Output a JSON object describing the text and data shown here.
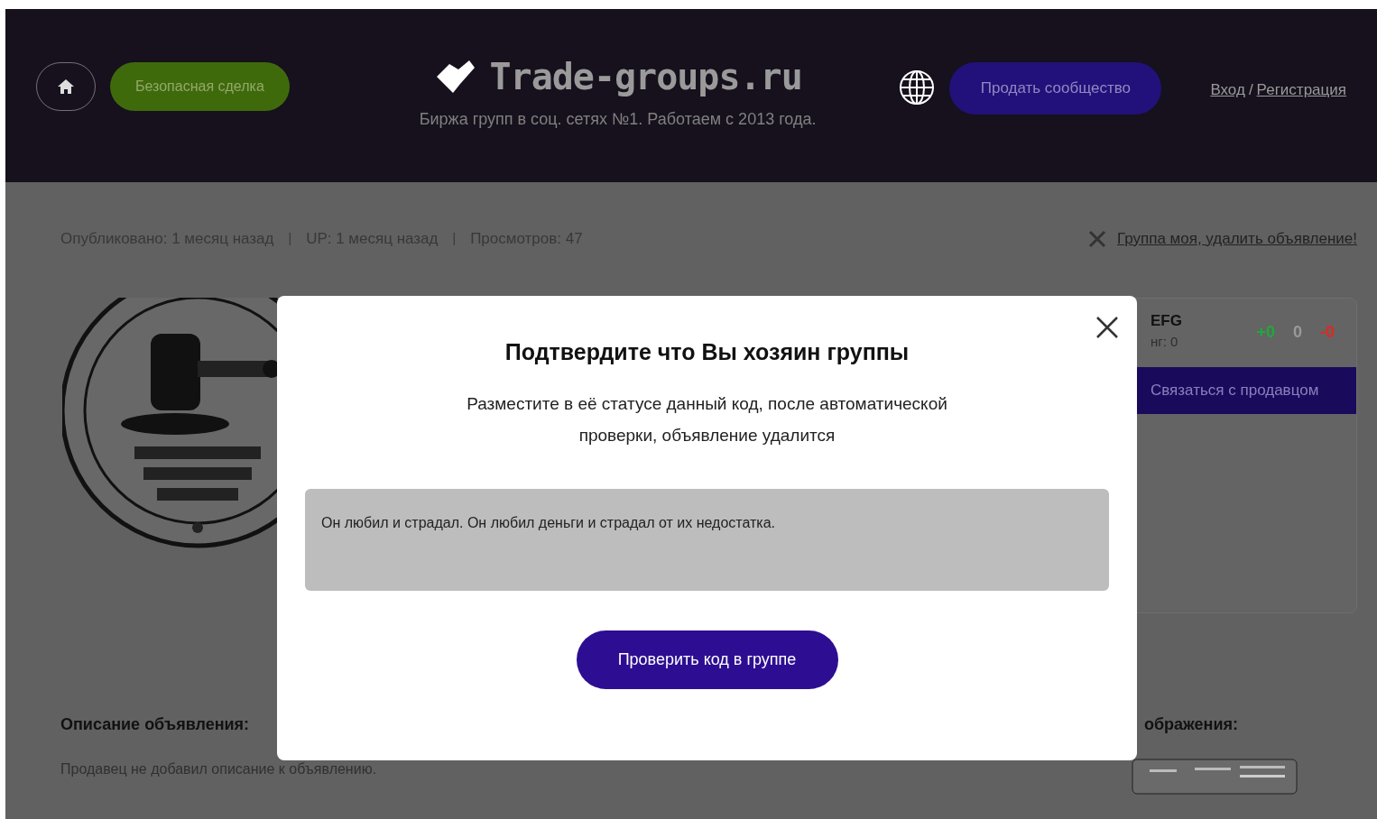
{
  "header": {
    "safe_deal_button": "Безопасная сделка",
    "logo_text": "Trade-groups.ru",
    "tagline": "Биржа групп в соц. сетях №1. Работаем с 2013 года.",
    "sell_button": "Продать сообщество",
    "login_link": "Вход",
    "separator": "/",
    "register_link": "Регистрация"
  },
  "meta": [
    {
      "text": "Опубликовано: 1 месяц назад"
    },
    {
      "text": "UP: 1 месяц назад"
    },
    {
      "text": "Просмотров: 47"
    }
  ],
  "meta_separator": "|",
  "delete_link": "Группа моя, удалить объявление!",
  "seller_card": {
    "name": "EFG",
    "rating": "нг: 0",
    "votes": [
      {
        "text": "+0",
        "color": "#22a83a"
      },
      {
        "text": "0",
        "color": "#9a9a9a"
      },
      {
        "text": "-0",
        "color": "#e0281e"
      }
    ],
    "contact_button": "Связаться с продавцом"
  },
  "description": {
    "heading": "Описание объявления:",
    "text": "Продавец не добавил описание к объявлению."
  },
  "images_section": {
    "heading": "ображения:"
  },
  "modal": {
    "title": "Подтвердите что Вы хозяин группы",
    "text": "Разместите в её статусе данный код, после автоматической проверки, объявление удалится",
    "code": "Он любил и страдал. Он любил деньги и страдал от их недостатка.",
    "check_button": "Проверить код в группе"
  }
}
